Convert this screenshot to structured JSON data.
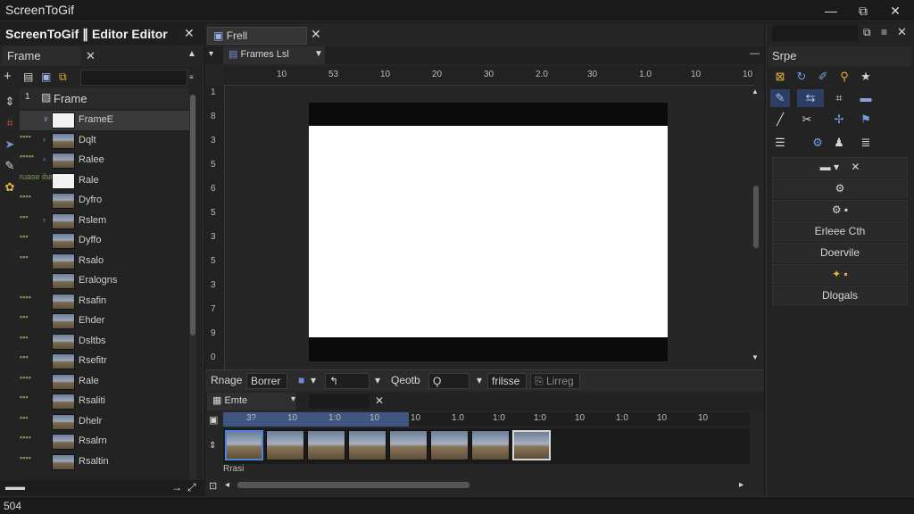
{
  "window": {
    "title": "ScreenToGif",
    "minimize": "—",
    "restore": "⧉",
    "close": "✕"
  },
  "left_panel": {
    "title": "ScreenToGif ∥ Editor Editor",
    "tab_label": "Frame",
    "tree_header": "Frame",
    "items": [
      {
        "label": "FrameE",
        "tag": "",
        "thumb": "white"
      },
      {
        "label": "Dqlt",
        "tag": "▪▪▪▪",
        "thumb": "photo"
      },
      {
        "label": "Ralee",
        "tag": "▪▪▪▪▪",
        "thumb": "photo"
      },
      {
        "label": "Rale",
        "tag": "ruase ibati",
        "thumb": "white"
      },
      {
        "label": "Dyfro",
        "tag": "▪▪▪▪",
        "thumb": "photo"
      },
      {
        "label": "Rslem",
        "tag": "▪▪▪",
        "thumb": "photo"
      },
      {
        "label": "Dyffo",
        "tag": "▪▪▪",
        "thumb": "photo"
      },
      {
        "label": "Rsalo",
        "tag": "▪▪▪",
        "thumb": "photo"
      },
      {
        "label": "Eralogns",
        "tag": "",
        "thumb": "photo"
      },
      {
        "label": "Rsafin",
        "tag": "▪▪▪▪",
        "thumb": "photo"
      },
      {
        "label": "Ehder",
        "tag": "▪▪▪",
        "thumb": "photo"
      },
      {
        "label": "Dsltbs",
        "tag": "▪▪▪",
        "thumb": "photo"
      },
      {
        "label": "Rsefitr",
        "tag": "▪▪▪",
        "thumb": "photo"
      },
      {
        "label": "Rale",
        "tag": "▪▪▪▪",
        "thumb": "photo"
      },
      {
        "label": "Rsaliti",
        "tag": "▪▪▪",
        "thumb": "photo"
      },
      {
        "label": "Dhelr",
        "tag": "▪▪▪",
        "thumb": "photo"
      },
      {
        "label": "Rsalrn",
        "tag": "▪▪▪▪",
        "thumb": "photo"
      },
      {
        "label": "Rsaltin",
        "tag": "▪▪▪▪",
        "thumb": "photo"
      }
    ]
  },
  "center": {
    "doc_tab": "Frell",
    "view_tab": "Frames Lsl",
    "ruler_h": [
      "10",
      "53",
      "10",
      "20",
      "30",
      "2.0",
      "30",
      "1.0",
      "10",
      "10"
    ],
    "ruler_v": [
      "1",
      "8",
      "3",
      "5",
      "6",
      "5",
      "3",
      "5",
      "3",
      "7",
      "9",
      "0"
    ],
    "edit_bar": {
      "image": "Rnage",
      "border": "Borrer",
      "depth": "Qeotb",
      "apply": "frilsse",
      "link": "Lirreg"
    },
    "timeline": {
      "tab": "Emte",
      "ruler": [
        "3?",
        "10",
        "1:0",
        "10",
        "10",
        "1.0",
        "1:0",
        "1:0",
        "10",
        "1:0",
        "10",
        "10"
      ],
      "frames": 8,
      "label": "Rrasi"
    }
  },
  "right_panel": {
    "header": "Srpe",
    "buttons": [
      "Erleee Cth",
      "Doervile",
      "Dlogals"
    ]
  },
  "status": {
    "text": "504"
  }
}
